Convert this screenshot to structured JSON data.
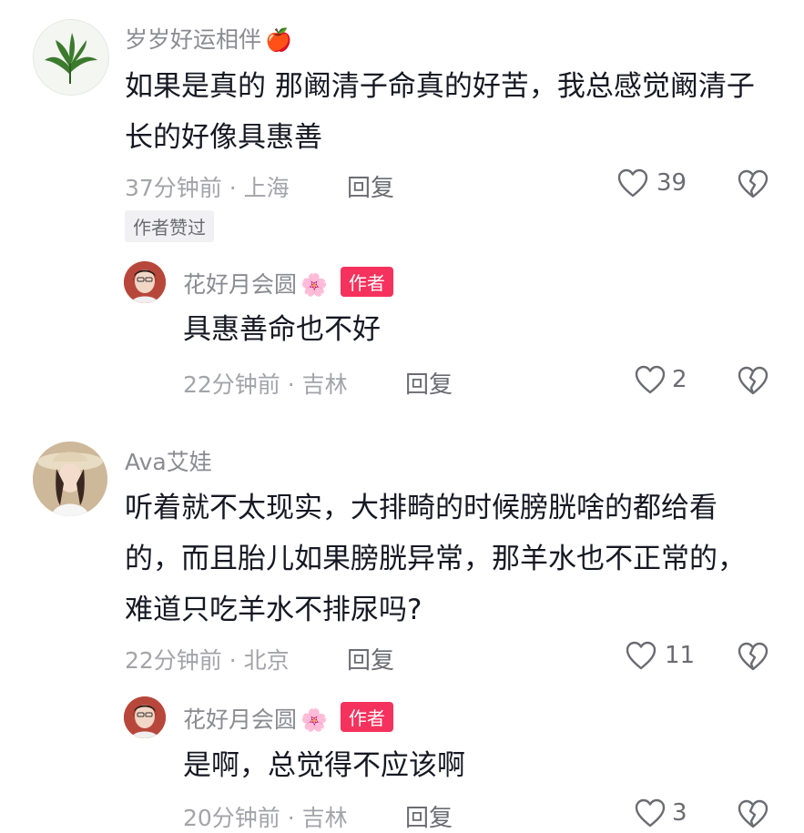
{
  "comments": [
    {
      "username": "岁岁好运相伴",
      "emoji": "🍎",
      "text": "如果是真的 那阚清子命真的好苦，我总感觉阚清子长的好像具惠善",
      "meta": "37分钟前 · 上海",
      "reply_label": "回复",
      "likes": "39",
      "badge": "作者赞过"
    },
    {
      "username": "Ava艾娃",
      "emoji": "",
      "text": "听着就不太现实，大排畸的时候膀胱啥的都给看的，而且胎儿如果膀胱异常，那羊水也不正常的，难道只吃羊水不排尿吗?",
      "meta": "22分钟前 · 北京",
      "reply_label": "回复",
      "likes": "11"
    }
  ],
  "replies": [
    {
      "username": "花好月会圆",
      "emoji": "🌸",
      "author_tag": "作者",
      "text": "具惠善命也不好",
      "meta": "22分钟前 · 吉林",
      "reply_label": "回复",
      "likes": "2"
    },
    {
      "username": "花好月会圆",
      "emoji": "🌸",
      "author_tag": "作者",
      "text": "是啊，总觉得不应该啊",
      "meta": "20分钟前 · 吉林",
      "reply_label": "回复",
      "likes": "3"
    }
  ],
  "colors": {
    "author_tag_bg": "#f5325d",
    "username": "#8a8b91",
    "meta": "#a3a4a9",
    "text": "#161823"
  },
  "icons": [
    "heart-outline-icon",
    "broken-heart-icon"
  ]
}
